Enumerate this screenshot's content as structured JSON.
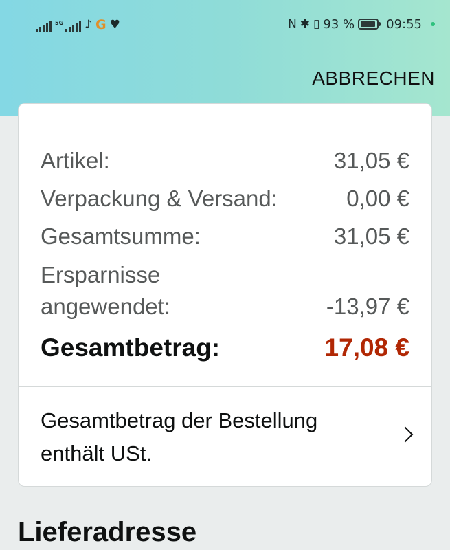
{
  "status_bar": {
    "signal1_label": "",
    "signal2_label": "5G",
    "battery_percent": "93 %",
    "battery_level": 0.93,
    "time": "09:55",
    "icons": [
      "signal-icon",
      "signal-5g-icon",
      "tiktok-icon",
      "g-app-icon",
      "health-icon",
      "nfc-icon",
      "bluetooth-icon",
      "vibrate-icon",
      "battery-icon"
    ]
  },
  "header": {
    "cancel_label": "ABBRECHEN"
  },
  "summary": {
    "items_label": "Artikel:",
    "items_value": "31,05 €",
    "shipping_label": "Verpackung & Versand:",
    "shipping_value": "0,00 €",
    "subtotal_label": "Gesamtsumme:",
    "subtotal_value": "31,05 €",
    "savings_label_line1": "Ersparnisse",
    "savings_label_line2": "angewendet:",
    "savings_value": "-13,97 €",
    "total_label": "Gesamtbetrag:",
    "total_value": "17,08 €"
  },
  "tax_info": {
    "line1": "Gesamtbetrag der Bestellung",
    "line2": "enthält USt."
  },
  "delivery": {
    "title": "Lieferadresse"
  },
  "colors": {
    "header_gradient_start": "#84d8e4",
    "header_gradient_end": "#a5e6cf",
    "total_price": "#b12704"
  }
}
